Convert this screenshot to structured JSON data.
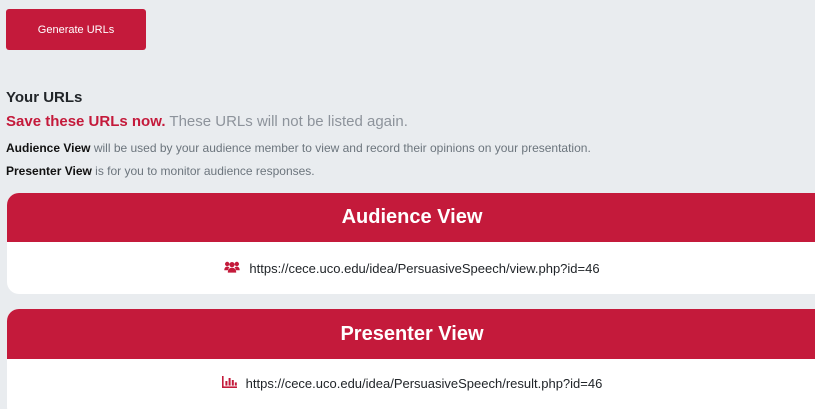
{
  "actions": {
    "generate_label": "Generate URLs"
  },
  "heading": "Your URLs",
  "notice": {
    "strong": "Save these URLs now.",
    "rest": "These URLs will not be listed again."
  },
  "descriptions": {
    "audience_label": "Audience View",
    "audience_text": "will be used by your audience member to view and record their opinions on your presentation.",
    "presenter_label": "Presenter View",
    "presenter_text": "is for you to monitor audience responses."
  },
  "cards": {
    "audience": {
      "title": "Audience View",
      "url": "https://cece.uco.edu/idea/PersuasiveSpeech/view.php?id=46",
      "icon": "users-icon"
    },
    "presenter": {
      "title": "Presenter View",
      "url": "https://cece.uco.edu/idea/PersuasiveSpeech/result.php?id=46",
      "icon": "bar-chart-icon"
    }
  },
  "colors": {
    "accent": "#c41a3b",
    "background": "#e9ecef",
    "card": "#ffffff",
    "muted_text": "#6c757d"
  }
}
